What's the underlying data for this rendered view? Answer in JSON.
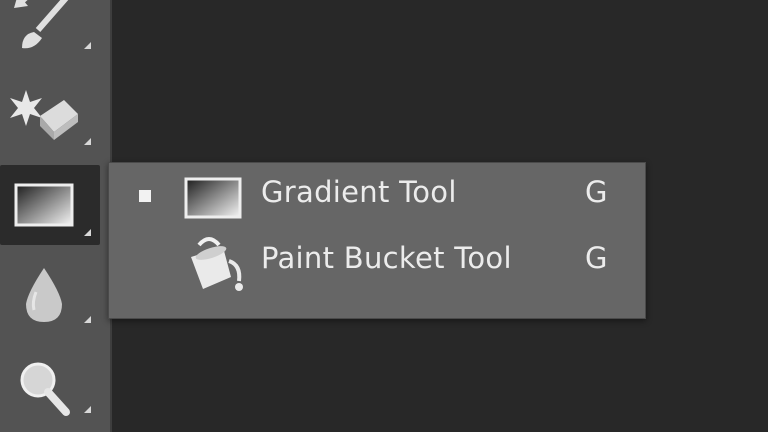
{
  "toolbar": {
    "tools": [
      {
        "name": "history-brush-tool",
        "icon": "history-brush-icon"
      },
      {
        "name": "eraser-tool",
        "icon": "eraser-icon"
      },
      {
        "name": "gradient-tool",
        "icon": "gradient-icon",
        "active": true
      },
      {
        "name": "blur-tool",
        "icon": "blur-drop-icon"
      },
      {
        "name": "dodge-tool",
        "icon": "dodge-icon"
      }
    ]
  },
  "flyout": {
    "items": [
      {
        "label": "Gradient Tool",
        "shortcut": "G",
        "icon": "gradient-icon",
        "selected": true
      },
      {
        "label": "Paint Bucket Tool",
        "shortcut": "G",
        "icon": "paint-bucket-icon",
        "selected": false
      }
    ]
  },
  "colors": {
    "toolbar_bg": "#535353",
    "canvas_bg": "#282828",
    "flyout_bg": "#666666",
    "text": "#ececec"
  }
}
